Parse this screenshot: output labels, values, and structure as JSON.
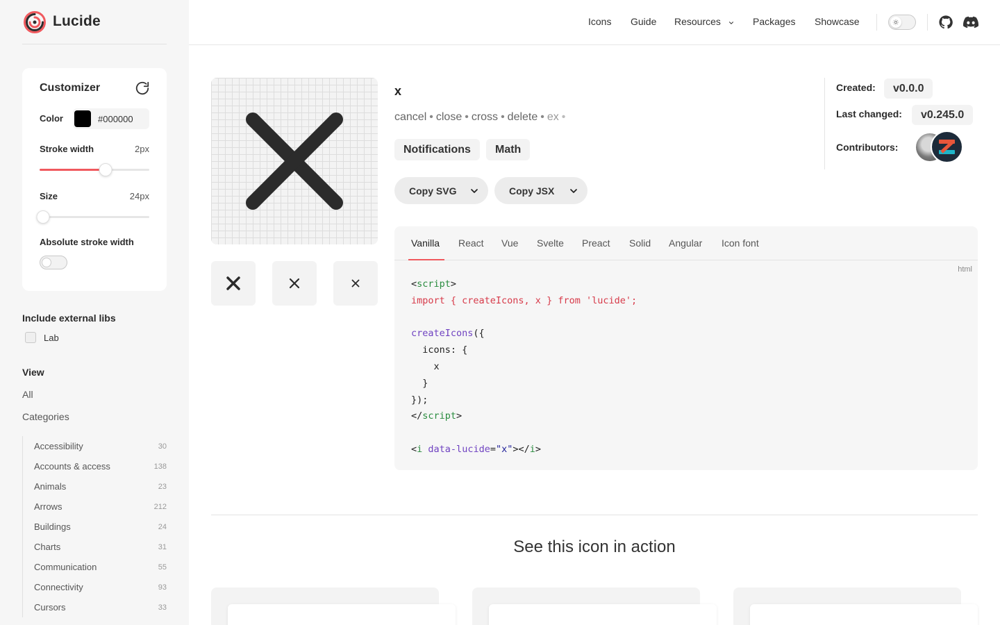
{
  "brand": {
    "name": "Lucide"
  },
  "nav": {
    "items": [
      "Icons",
      "Guide",
      "Resources",
      "Packages",
      "Showcase"
    ]
  },
  "customizer": {
    "title": "Customizer",
    "color_label": "Color",
    "color_value": "#000000",
    "stroke_label": "Stroke width",
    "stroke_value": "2px",
    "stroke_fraction": 0.6,
    "size_label": "Size",
    "size_value": "24px",
    "size_fraction": 0.03,
    "absolute_label": "Absolute stroke width",
    "absolute_enabled": false
  },
  "external_libs": {
    "title": "Include external libs",
    "option": "Lab"
  },
  "view": {
    "title": "View",
    "all": "All",
    "categories_label": "Categories",
    "categories": [
      {
        "name": "Accessibility",
        "count": "30"
      },
      {
        "name": "Accounts & access",
        "count": "138"
      },
      {
        "name": "Animals",
        "count": "23"
      },
      {
        "name": "Arrows",
        "count": "212"
      },
      {
        "name": "Buildings",
        "count": "24"
      },
      {
        "name": "Charts",
        "count": "31"
      },
      {
        "name": "Communication",
        "count": "55"
      },
      {
        "name": "Connectivity",
        "count": "93"
      },
      {
        "name": "Cursors",
        "count": "33"
      }
    ]
  },
  "icon": {
    "name": "x",
    "tags": [
      "cancel",
      "close",
      "cross",
      "delete",
      "ex"
    ],
    "categories": [
      "Notifications",
      "Math"
    ],
    "copy_svg": "Copy SVG",
    "copy_jsx": "Copy JSX"
  },
  "meta": {
    "created_label": "Created:",
    "created_value": "v0.0.0",
    "changed_label": "Last changed:",
    "changed_value": "v0.245.0",
    "contributors_label": "Contributors:"
  },
  "code": {
    "tabs": [
      "Vanilla",
      "React",
      "Vue",
      "Svelte",
      "Preact",
      "Solid",
      "Angular",
      "Icon font"
    ],
    "active_tab": "Vanilla",
    "lang": "html"
  },
  "section": {
    "title": "See this icon in action"
  },
  "colors": {
    "accent": "#f0595e",
    "sidebar_bg": "#f6f6f6"
  }
}
